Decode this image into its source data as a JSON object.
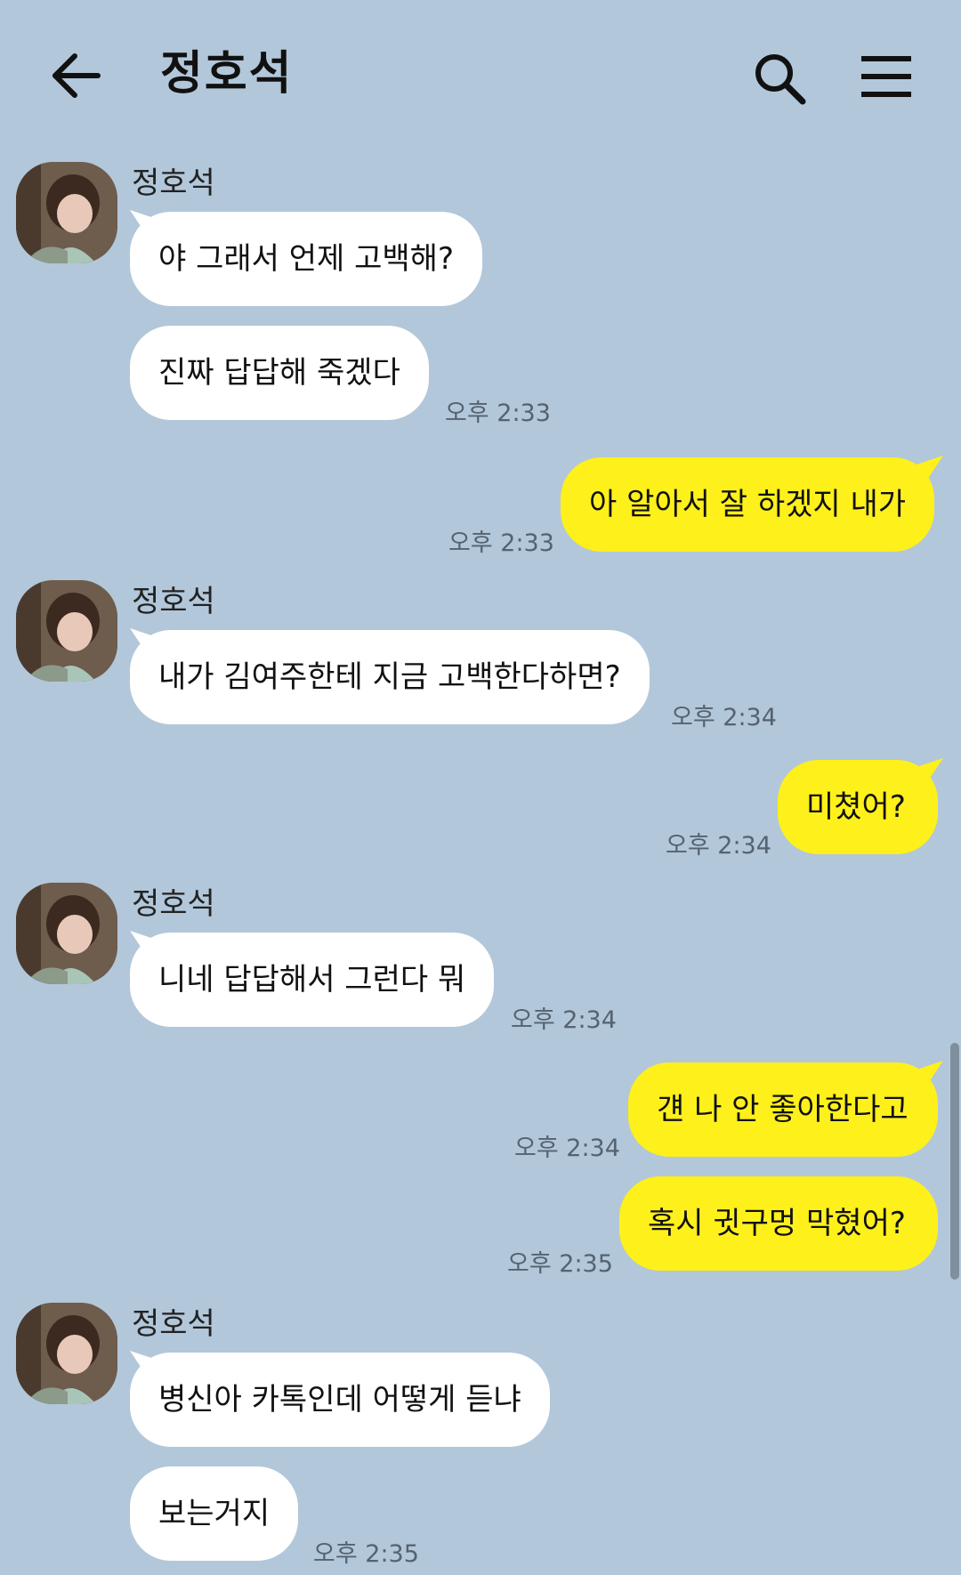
{
  "header": {
    "title": "정호석",
    "back_icon": "arrow-left-icon",
    "search_icon": "search-icon",
    "menu_icon": "hamburger-menu-icon"
  },
  "colors": {
    "background": "#b2c7da",
    "incoming_bubble": "#ffffff",
    "outgoing_bubble": "#fef01b"
  },
  "messages": {
    "m1": {
      "sender": "정호석",
      "text": "야 그래서 언제 고백해?"
    },
    "m2": {
      "text": "진짜 답답해 죽겠다",
      "time": "오후 2:33"
    },
    "m3": {
      "text": "아 알아서 잘 하겠지 내가",
      "time": "오후 2:33"
    },
    "m4": {
      "sender": "정호석",
      "text": "내가 김여주한테 지금 고백한다하면?",
      "time": "오후 2:34"
    },
    "m5": {
      "text": "미쳤어?",
      "time": "오후 2:34"
    },
    "m6": {
      "sender": "정호석",
      "text": "니네 답답해서 그런다 뭐",
      "time": "오후 2:34"
    },
    "m7": {
      "text": "걘 나 안 좋아한다고",
      "time": "오후 2:34"
    },
    "m8": {
      "text": "혹시 귓구멍 막혔어?",
      "time": "오후 2:35"
    },
    "m9": {
      "sender": "정호석",
      "text": "병신아 카톡인데 어떻게 듣냐"
    },
    "m10": {
      "text": "보는거지",
      "time": "오후 2:35"
    }
  }
}
